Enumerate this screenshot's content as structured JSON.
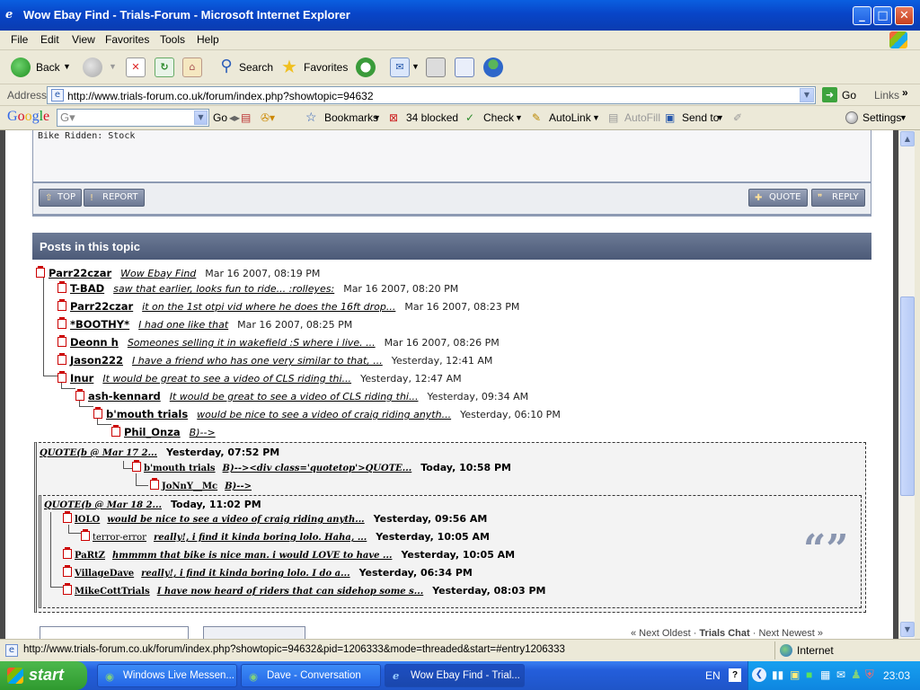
{
  "window": {
    "title": "Wow Ebay Find - Trials-Forum - Microsoft Internet Explorer"
  },
  "menu": [
    "File",
    "Edit",
    "View",
    "Favorites",
    "Tools",
    "Help"
  ],
  "toolbar": {
    "back": "Back",
    "search": "Search",
    "favorites": "Favorites"
  },
  "address": {
    "label": "Address",
    "url": "http://www.trials-forum.co.uk/forum/index.php?showtopic=94632",
    "go": "Go",
    "links": "Links"
  },
  "googlebar": {
    "logo": "Google",
    "go": "Go",
    "bookmarks": "Bookmarks",
    "blocked": "34 blocked",
    "check": "Check",
    "autolink": "AutoLink",
    "autofill": "AutoFill",
    "sendto": "Send to",
    "settings": "Settings"
  },
  "post": {
    "bike_ridden": "Bike Ridden: Stock",
    "top": "TOP",
    "report": "REPORT",
    "quote": "QUOTE",
    "reply": "REPLY"
  },
  "topic": {
    "header": "Posts in this topic",
    "posts": [
      {
        "user": "Parr22czar",
        "subject": "Wow Ebay Find",
        "date": "Mar 16 2007, 08:19 PM"
      },
      {
        "user": "T-BAD",
        "subject": "saw that earlier, looks fun to ride... :rolleyes:",
        "date": "Mar 16 2007, 08:20 PM"
      },
      {
        "user": "Parr22czar",
        "subject": "it on the 1st otpi vid where he does the 16ft drop...",
        "date": "Mar 16 2007, 08:23 PM"
      },
      {
        "user": "*BOOTHY*",
        "subject": "I had one like that",
        "date": "Mar 16 2007, 08:25 PM"
      },
      {
        "user": "Deonn h",
        "subject": "Someones selling it in wakefield :S where i live. ...",
        "date": "Mar 16 2007, 08:26 PM"
      },
      {
        "user": "Jason222",
        "subject": "I have a friend who has one very similar to that, ...",
        "date": "Yesterday, 12:41 AM"
      },
      {
        "user": "Inur",
        "subject": "It would be great to see a video of CLS riding thi...",
        "date": "Yesterday, 12:47 AM"
      },
      {
        "user": "ash-kennard",
        "subject": "It would be great to see a video of CLS riding thi...",
        "date": "Yesterday, 09:34 AM"
      },
      {
        "user": "b'mouth trials",
        "subject": "would be nice to see a video of craig riding anyth...",
        "date": "Yesterday, 06:10 PM"
      },
      {
        "user": "Phil_Onza",
        "subject": "B)-->",
        "date": ""
      }
    ],
    "quote1": {
      "head": "QUOTE(b @ Mar 17 2...",
      "date": "Yesterday, 07:52 PM",
      "rows": [
        {
          "user": "b'mouth trials",
          "subject": "B)--><div class='quotetop'>QUOTE...",
          "date": "Today, 10:58 PM"
        },
        {
          "user": "JoNnY__Mc",
          "subject": "B)-->",
          "date": ""
        }
      ]
    },
    "quote2": {
      "head": "QUOTE(b @ Mar 18 2...",
      "date": "Today, 11:02 PM",
      "rows": [
        {
          "user": "lOLO",
          "subject": "would be nice to see a video of craig riding anyth...",
          "date": "Yesterday, 09:56 AM"
        },
        {
          "user": "terror-error",
          "subject": "really!, i find it kinda boring lolo. Haha, ...",
          "date": "Yesterday, 10:05 AM"
        },
        {
          "user": "PaRtZ",
          "subject": "hmmmm that bike is nice man. i would LOVE to have ...",
          "date": "Yesterday, 10:05 AM"
        },
        {
          "user": "VillageDave",
          "subject": "really!, i find it kinda boring lolo. I do a...",
          "date": "Yesterday, 06:34 PM"
        },
        {
          "user": "MikeCottTrials",
          "subject": "I have now heard of riders that can sidehop some s...",
          "date": "Yesterday, 08:03 PM"
        }
      ]
    },
    "nav": {
      "prev": "« Next Oldest",
      "sep": " · ",
      "forum": "Trials Chat",
      "next": "Next Newest »"
    }
  },
  "status": {
    "url": "http://www.trials-forum.co.uk/forum/index.php?showtopic=94632&pid=1206333&mode=threaded&start=#entry1206333",
    "zone": "Internet"
  },
  "taskbar": {
    "start": "start",
    "tasks": [
      "Windows Live Messen...",
      "Dave - Conversation",
      "Wow Ebay Find - Trial..."
    ],
    "lang": "EN",
    "time": "23:03"
  }
}
